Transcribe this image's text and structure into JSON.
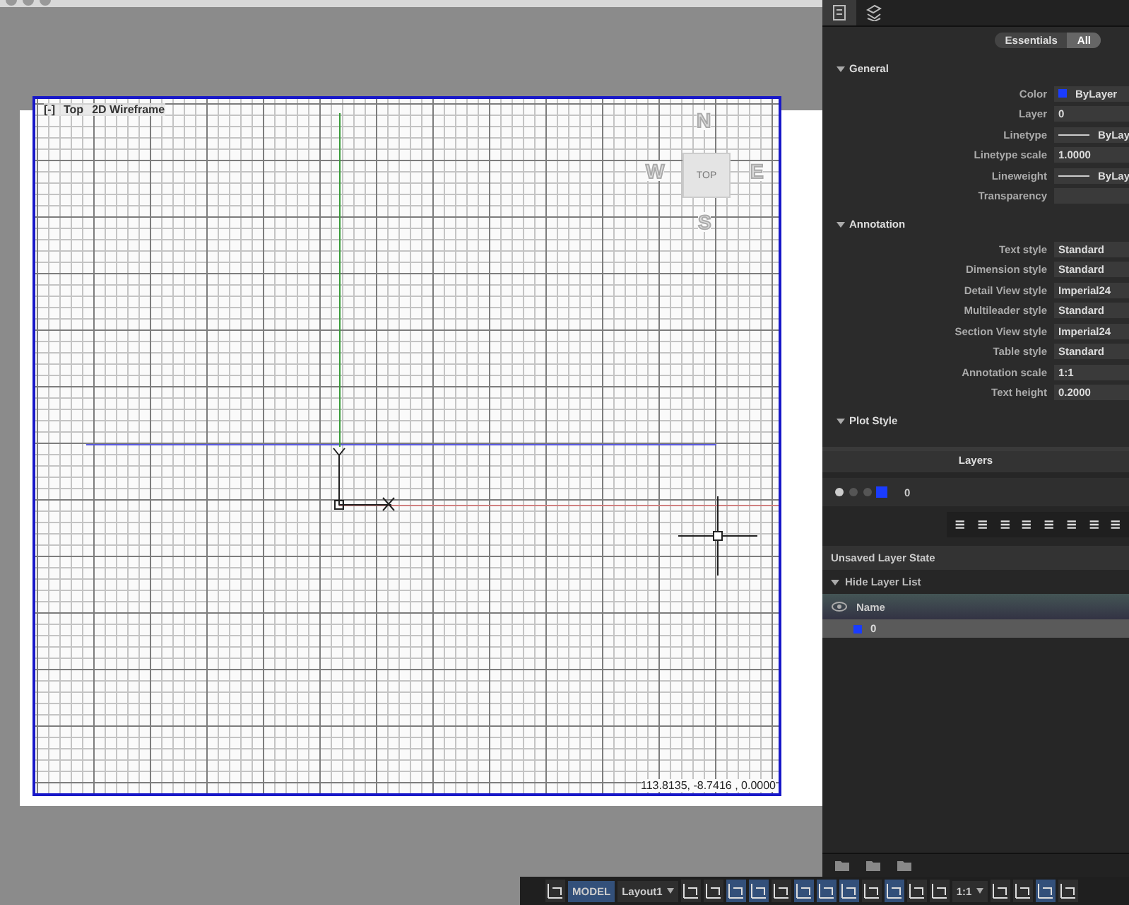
{
  "viewport": {
    "controls": "[-]",
    "view": "Top",
    "style": "2D Wireframe",
    "coordinates": "113.8135, -8.7416 , 0.0000"
  },
  "viewcube": {
    "north": "N",
    "south": "S",
    "east": "E",
    "west": "W",
    "face": "TOP"
  },
  "properties": {
    "filters": [
      {
        "label": "Essentials",
        "selected": false
      },
      {
        "label": "All",
        "selected": true
      }
    ],
    "sections": [
      {
        "title": "General",
        "expanded": true,
        "rows": [
          {
            "label": "Color",
            "value": "ByLayer",
            "kind": "color",
            "color": "#1a3cff"
          },
          {
            "label": "Layer",
            "value": "0",
            "kind": "text"
          },
          {
            "label": "Linetype",
            "value": "ByLay",
            "kind": "line"
          },
          {
            "label": "Linetype scale",
            "value": "1.0000",
            "kind": "text"
          },
          {
            "label": "Lineweight",
            "value": "ByLay",
            "kind": "line"
          },
          {
            "label": "Transparency",
            "kind": "text"
          }
        ]
      },
      {
        "title": "Annotation",
        "expanded": true,
        "rows": [
          {
            "label": "Text style",
            "value": "Standard",
            "kind": "text"
          },
          {
            "label": "Dimension style",
            "value": "Standard",
            "kind": "text"
          },
          {
            "label": "Detail View style",
            "value": "Imperial24",
            "kind": "text"
          },
          {
            "label": "Multileader style",
            "value": "Standard",
            "kind": "text"
          },
          {
            "label": "Section View style",
            "value": "Imperial24",
            "kind": "text"
          },
          {
            "label": "Table style",
            "value": "Standard",
            "kind": "text"
          },
          {
            "label": "Annotation scale",
            "value": "1:1",
            "kind": "text"
          },
          {
            "label": "Text height",
            "value": "0.2000",
            "kind": "text"
          }
        ]
      },
      {
        "title": "Plot Style",
        "expanded": true
      }
    ]
  },
  "layers": {
    "title": "Layers",
    "current_layer": "0",
    "layer_state": "Unsaved Layer State",
    "list_toggle": "Hide Layer List",
    "list_expanded": true,
    "columns": [
      "Name"
    ],
    "rows": [
      {
        "name": "0",
        "color": "#1a3cff",
        "selected": true
      }
    ]
  },
  "status_bar": {
    "items": [
      {
        "kind": "icon",
        "on": false
      },
      {
        "kind": "label",
        "text": "MODEL",
        "on": true
      },
      {
        "kind": "menu",
        "text": "Layout1",
        "on": false
      },
      {
        "kind": "icon",
        "on": false
      },
      {
        "kind": "icon",
        "on": false
      },
      {
        "kind": "icon",
        "on": true
      },
      {
        "kind": "icon",
        "on": true
      },
      {
        "kind": "icon",
        "on": false
      },
      {
        "kind": "icon",
        "on": true
      },
      {
        "kind": "icon",
        "on": true
      },
      {
        "kind": "icon",
        "on": true
      },
      {
        "kind": "icon",
        "on": false
      },
      {
        "kind": "icon",
        "on": true
      },
      {
        "kind": "icon",
        "on": false
      },
      {
        "kind": "icon",
        "on": false
      },
      {
        "kind": "menu",
        "text": "1:1",
        "on": false
      },
      {
        "kind": "icon",
        "on": false
      },
      {
        "kind": "icon",
        "on": false
      },
      {
        "kind": "icon",
        "on": true
      },
      {
        "kind": "icon",
        "on": false
      }
    ]
  }
}
